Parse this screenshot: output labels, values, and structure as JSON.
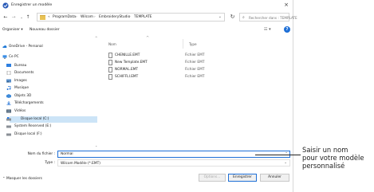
{
  "window": {
    "title": "Enregistrer un modèle",
    "close_label": "×"
  },
  "navigation": {
    "back": "←",
    "forward": "→",
    "up_menu": "⌄",
    "up": "↑",
    "breadcrumb": [
      "ProgramData",
      "Wilcom",
      "EmbroideryStudio",
      "TEMPLATE"
    ],
    "breadcrumb_prefix": "«",
    "search_placeholder": "Rechercher dans : TEMPLATE"
  },
  "command_bar": {
    "organize": "Organiser ▾",
    "new_folder": "Nouveau dossier",
    "view": "☷ ▾",
    "help": "?"
  },
  "sidebar": {
    "items": [
      {
        "label": "OneDrive - Personal",
        "icon": "cloud-icon"
      },
      {
        "label": "Ce PC",
        "icon": "pc-icon"
      },
      {
        "label": "Bureau",
        "icon": "desktop-icon"
      },
      {
        "label": "Documents",
        "icon": "documents-icon"
      },
      {
        "label": "Images",
        "icon": "pictures-icon"
      },
      {
        "label": "Musique",
        "icon": "music-icon"
      },
      {
        "label": "Objets 3D",
        "icon": "objects-3d-icon"
      },
      {
        "label": "Téléchargements",
        "icon": "downloads-icon"
      },
      {
        "label": "Vidéos",
        "icon": "videos-icon"
      },
      {
        "label": "Disque local (C:)",
        "icon": "drive-icon"
      },
      {
        "label": "System Reserved (E:)",
        "icon": "drive-icon"
      },
      {
        "label": "Disque local (F:)",
        "icon": "drive-icon"
      }
    ]
  },
  "file_list": {
    "columns": [
      "Nom",
      "Type"
    ],
    "rows": [
      {
        "name": "CHENILLE.EMT",
        "type": "Fichier EMT"
      },
      {
        "name": "New Template.EMT",
        "type": "Fichier EMT"
      },
      {
        "name": "NORMAL.EMT",
        "type": "Fichier EMT"
      },
      {
        "name": "SCHIFFLI.EMT",
        "type": "Fichier EMT"
      }
    ]
  },
  "form": {
    "filename_label": "Nom du fichier :",
    "filename_value": "Normal",
    "type_label": "Type :",
    "type_value": "Wilcom Modèle (*.EMT)",
    "hide_folders": "⌃ Masquer les dossiers",
    "options_label": "Options...",
    "save_label": "Enregistrer",
    "cancel_label": "Annuler"
  },
  "annotation": {
    "lines": [
      "Saisir un nom",
      "pour votre modèle",
      "personnalisé"
    ]
  },
  "colors": {
    "accent": "#1e6fd6",
    "selection": "#cce4f7",
    "folder": "#e8c255"
  }
}
